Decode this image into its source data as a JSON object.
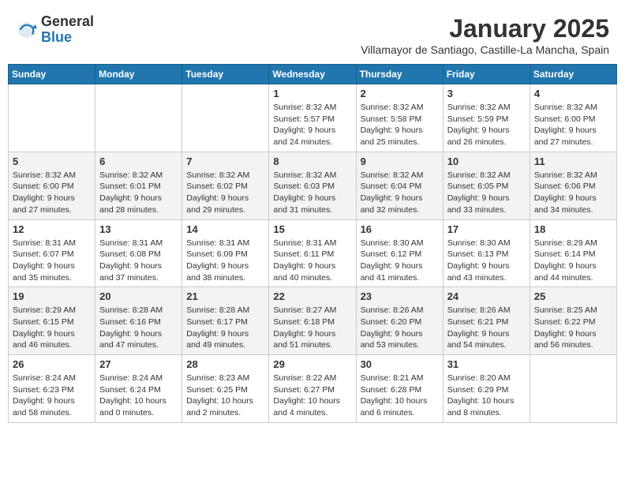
{
  "header": {
    "logo_general": "General",
    "logo_blue": "Blue",
    "month_title": "January 2025",
    "subtitle": "Villamayor de Santiago, Castille-La Mancha, Spain"
  },
  "weekdays": [
    "Sunday",
    "Monday",
    "Tuesday",
    "Wednesday",
    "Thursday",
    "Friday",
    "Saturday"
  ],
  "weeks": [
    [
      {
        "day": "",
        "detail": ""
      },
      {
        "day": "",
        "detail": ""
      },
      {
        "day": "",
        "detail": ""
      },
      {
        "day": "1",
        "detail": "Sunrise: 8:32 AM\nSunset: 5:57 PM\nDaylight: 9 hours\nand 24 minutes."
      },
      {
        "day": "2",
        "detail": "Sunrise: 8:32 AM\nSunset: 5:58 PM\nDaylight: 9 hours\nand 25 minutes."
      },
      {
        "day": "3",
        "detail": "Sunrise: 8:32 AM\nSunset: 5:59 PM\nDaylight: 9 hours\nand 26 minutes."
      },
      {
        "day": "4",
        "detail": "Sunrise: 8:32 AM\nSunset: 6:00 PM\nDaylight: 9 hours\nand 27 minutes."
      }
    ],
    [
      {
        "day": "5",
        "detail": "Sunrise: 8:32 AM\nSunset: 6:00 PM\nDaylight: 9 hours\nand 27 minutes."
      },
      {
        "day": "6",
        "detail": "Sunrise: 8:32 AM\nSunset: 6:01 PM\nDaylight: 9 hours\nand 28 minutes."
      },
      {
        "day": "7",
        "detail": "Sunrise: 8:32 AM\nSunset: 6:02 PM\nDaylight: 9 hours\nand 29 minutes."
      },
      {
        "day": "8",
        "detail": "Sunrise: 8:32 AM\nSunset: 6:03 PM\nDaylight: 9 hours\nand 31 minutes."
      },
      {
        "day": "9",
        "detail": "Sunrise: 8:32 AM\nSunset: 6:04 PM\nDaylight: 9 hours\nand 32 minutes."
      },
      {
        "day": "10",
        "detail": "Sunrise: 8:32 AM\nSunset: 6:05 PM\nDaylight: 9 hours\nand 33 minutes."
      },
      {
        "day": "11",
        "detail": "Sunrise: 8:32 AM\nSunset: 6:06 PM\nDaylight: 9 hours\nand 34 minutes."
      }
    ],
    [
      {
        "day": "12",
        "detail": "Sunrise: 8:31 AM\nSunset: 6:07 PM\nDaylight: 9 hours\nand 35 minutes."
      },
      {
        "day": "13",
        "detail": "Sunrise: 8:31 AM\nSunset: 6:08 PM\nDaylight: 9 hours\nand 37 minutes."
      },
      {
        "day": "14",
        "detail": "Sunrise: 8:31 AM\nSunset: 6:09 PM\nDaylight: 9 hours\nand 38 minutes."
      },
      {
        "day": "15",
        "detail": "Sunrise: 8:31 AM\nSunset: 6:11 PM\nDaylight: 9 hours\nand 40 minutes."
      },
      {
        "day": "16",
        "detail": "Sunrise: 8:30 AM\nSunset: 6:12 PM\nDaylight: 9 hours\nand 41 minutes."
      },
      {
        "day": "17",
        "detail": "Sunrise: 8:30 AM\nSunset: 6:13 PM\nDaylight: 9 hours\nand 43 minutes."
      },
      {
        "day": "18",
        "detail": "Sunrise: 8:29 AM\nSunset: 6:14 PM\nDaylight: 9 hours\nand 44 minutes."
      }
    ],
    [
      {
        "day": "19",
        "detail": "Sunrise: 8:29 AM\nSunset: 6:15 PM\nDaylight: 9 hours\nand 46 minutes."
      },
      {
        "day": "20",
        "detail": "Sunrise: 8:28 AM\nSunset: 6:16 PM\nDaylight: 9 hours\nand 47 minutes."
      },
      {
        "day": "21",
        "detail": "Sunrise: 8:28 AM\nSunset: 6:17 PM\nDaylight: 9 hours\nand 49 minutes."
      },
      {
        "day": "22",
        "detail": "Sunrise: 8:27 AM\nSunset: 6:18 PM\nDaylight: 9 hours\nand 51 minutes."
      },
      {
        "day": "23",
        "detail": "Sunrise: 8:26 AM\nSunset: 6:20 PM\nDaylight: 9 hours\nand 53 minutes."
      },
      {
        "day": "24",
        "detail": "Sunrise: 8:26 AM\nSunset: 6:21 PM\nDaylight: 9 hours\nand 54 minutes."
      },
      {
        "day": "25",
        "detail": "Sunrise: 8:25 AM\nSunset: 6:22 PM\nDaylight: 9 hours\nand 56 minutes."
      }
    ],
    [
      {
        "day": "26",
        "detail": "Sunrise: 8:24 AM\nSunset: 6:23 PM\nDaylight: 9 hours\nand 58 minutes."
      },
      {
        "day": "27",
        "detail": "Sunrise: 8:24 AM\nSunset: 6:24 PM\nDaylight: 10 hours\nand 0 minutes."
      },
      {
        "day": "28",
        "detail": "Sunrise: 8:23 AM\nSunset: 6:25 PM\nDaylight: 10 hours\nand 2 minutes."
      },
      {
        "day": "29",
        "detail": "Sunrise: 8:22 AM\nSunset: 6:27 PM\nDaylight: 10 hours\nand 4 minutes."
      },
      {
        "day": "30",
        "detail": "Sunrise: 8:21 AM\nSunset: 6:28 PM\nDaylight: 10 hours\nand 6 minutes."
      },
      {
        "day": "31",
        "detail": "Sunrise: 8:20 AM\nSunset: 6:29 PM\nDaylight: 10 hours\nand 8 minutes."
      },
      {
        "day": "",
        "detail": ""
      }
    ]
  ]
}
